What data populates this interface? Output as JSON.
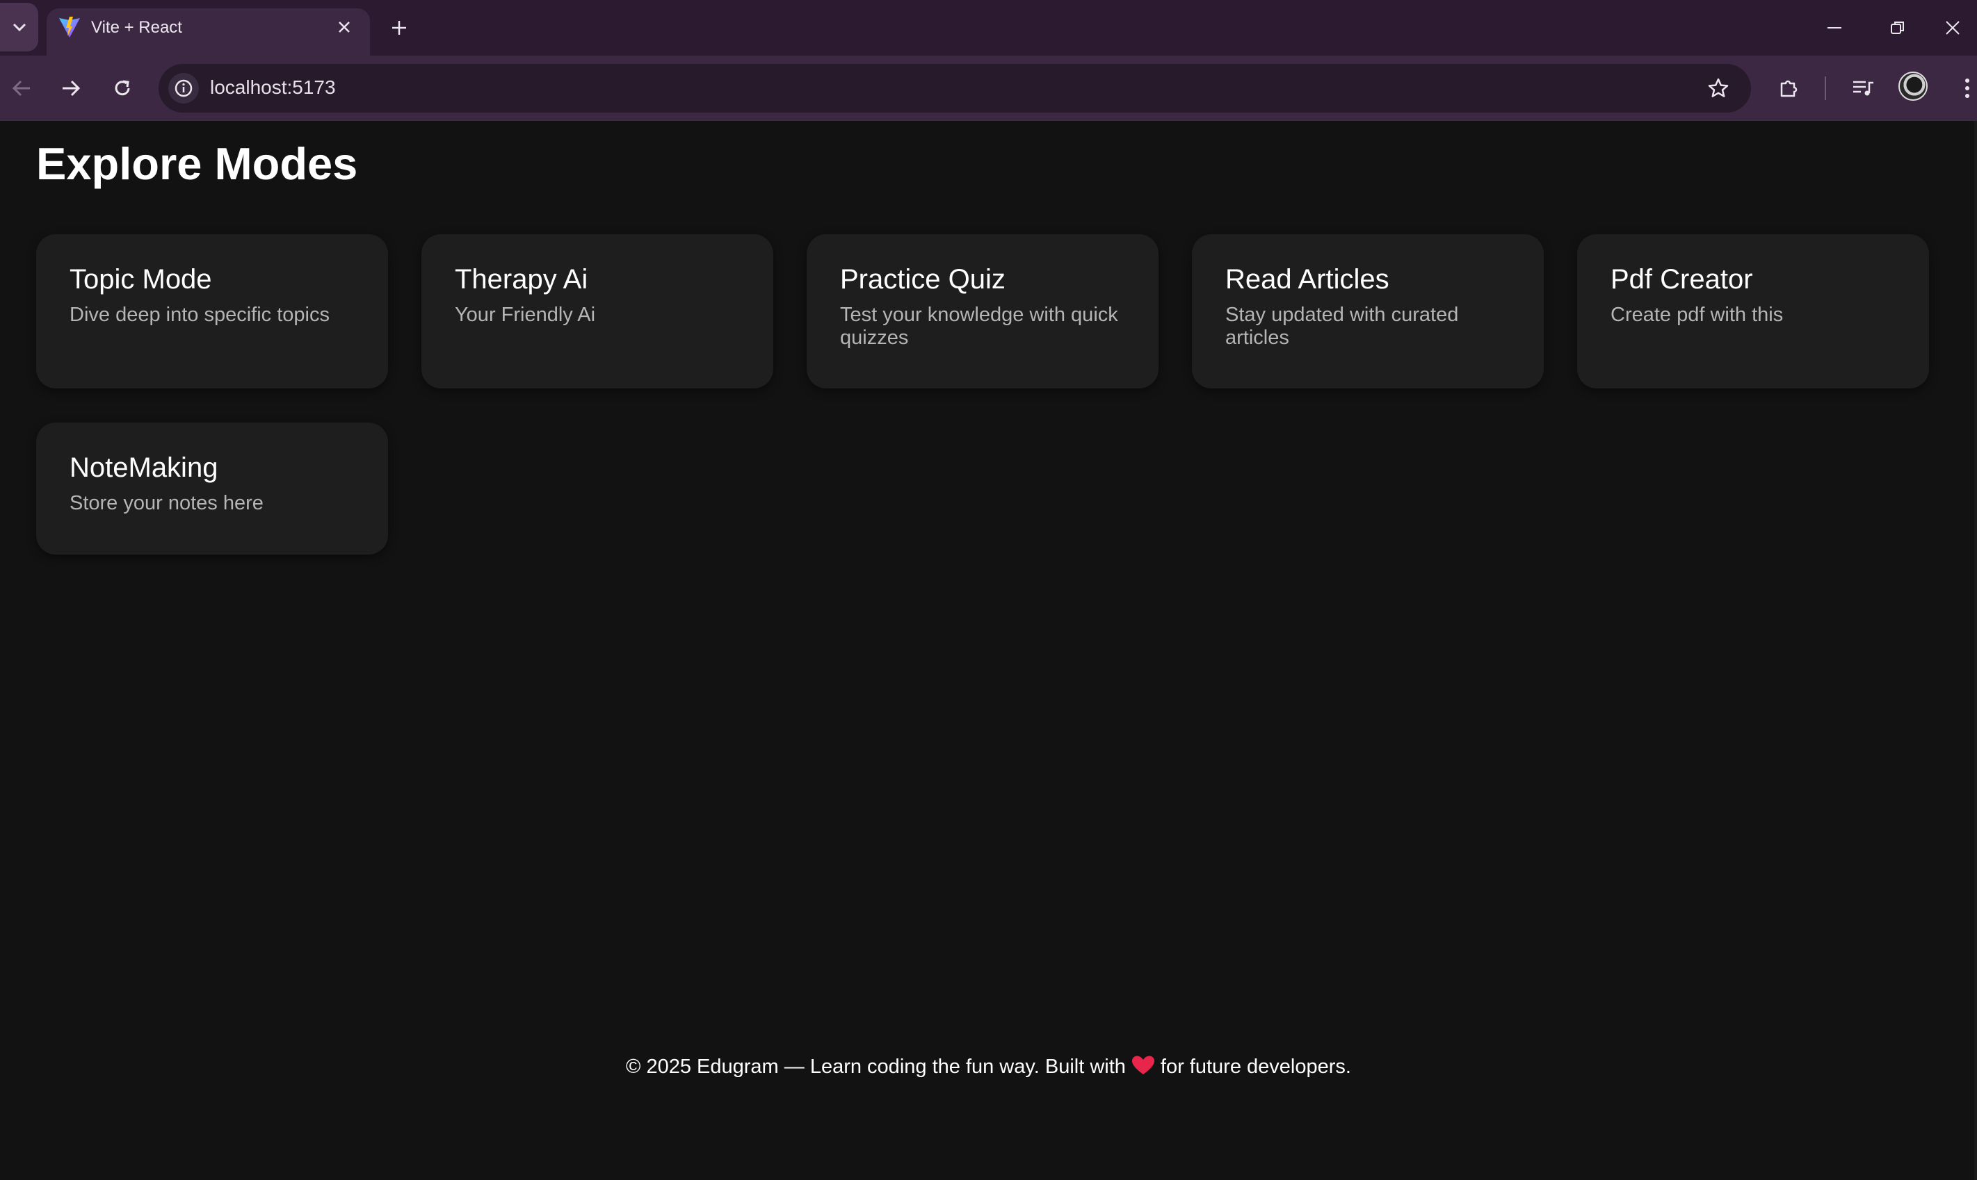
{
  "browser": {
    "tab_title": "Vite + React",
    "url": "localhost:5173"
  },
  "page": {
    "title": "Explore Modes",
    "cards": [
      {
        "title": "Topic Mode",
        "description": "Dive deep into specific topics"
      },
      {
        "title": "Therapy Ai",
        "description": "Your Friendly Ai"
      },
      {
        "title": "Practice Quiz",
        "description": "Test your knowledge with quick quizzes"
      },
      {
        "title": "Read Articles",
        "description": "Stay updated with curated articles"
      },
      {
        "title": "Pdf Creator",
        "description": "Create pdf with this"
      },
      {
        "title": "NoteMaking",
        "description": "Store your notes here"
      }
    ],
    "footer": {
      "before": "© 2025 Edugram — Learn coding the fun way. Built with",
      "after": "for future developers."
    }
  },
  "colors": {
    "background": "#121212",
    "card": "#1e1e1e",
    "heart": "#e8254a",
    "chrome_frame": "#2b1a30",
    "chrome_toolbar": "#3d2844"
  }
}
